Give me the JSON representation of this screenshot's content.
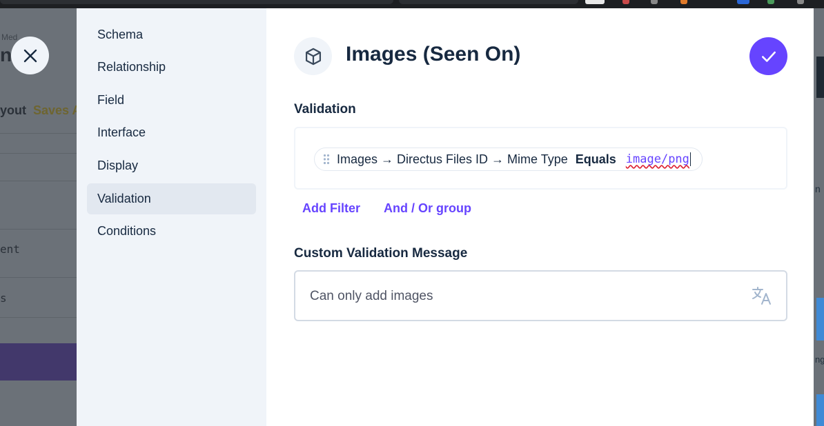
{
  "background": {
    "breadcrumb": "Med",
    "title": "n",
    "layout_label": "yout",
    "saves_label": "Saves A",
    "mono_lines": [
      "ent",
      "s"
    ]
  },
  "right_edge": {
    "glyphs": [
      "n",
      "ng"
    ]
  },
  "nav": {
    "items": [
      {
        "label": "Schema"
      },
      {
        "label": "Relationship"
      },
      {
        "label": "Field"
      },
      {
        "label": "Interface"
      },
      {
        "label": "Display"
      },
      {
        "label": "Validation",
        "active": true
      },
      {
        "label": "Conditions"
      }
    ]
  },
  "header": {
    "title": "Images (Seen On)",
    "icon": "box-icon",
    "confirm_icon": "check-icon",
    "close_icon": "close-icon"
  },
  "validation": {
    "label": "Validation",
    "filter": {
      "field": "Images → Directus Files ID → Mime Type",
      "operator": "Equals",
      "value": "image/png"
    },
    "add_filter_label": "Add Filter",
    "and_or_group_label": "And / Or group"
  },
  "custom_message": {
    "label": "Custom Validation Message",
    "value": "Can only add images",
    "icon": "translate-icon"
  },
  "colors": {
    "accent": "#6644ff",
    "nav_bg": "#f0f4f9",
    "text": "#172940"
  }
}
